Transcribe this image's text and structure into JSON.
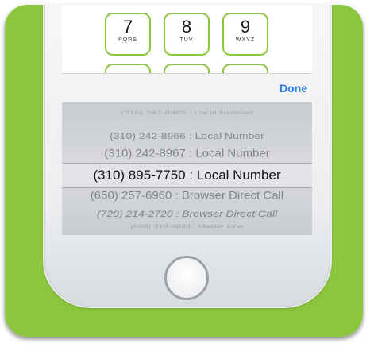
{
  "keypad": {
    "keys": [
      {
        "digit": "7",
        "letters": "PQRS"
      },
      {
        "digit": "8",
        "letters": "TUV"
      },
      {
        "digit": "9",
        "letters": "WXYZ"
      }
    ]
  },
  "toolbar": {
    "done_label": "Done"
  },
  "picker": {
    "options": [
      "(310) 242-8965 : Local Number",
      "(310) 242-8966 : Local Number",
      "(310) 242-8967 : Local Number",
      "(310) 895-7750 : Local Number",
      "(650) 257-6960 : Browser Direct Call",
      "(720) 214-2720 : Browser Direct Call",
      "(866) 319-8833 : Master Line"
    ],
    "selected_index": 3
  },
  "colors": {
    "accent": "#8cc63f",
    "link": "#2f7ae5"
  },
  "icons": {
    "home": "home-button"
  }
}
